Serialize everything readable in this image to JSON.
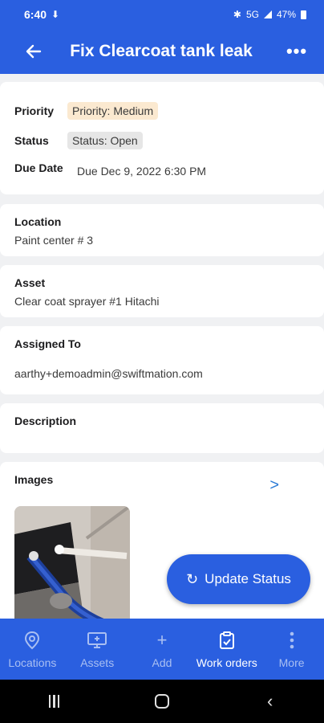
{
  "status_bar": {
    "time": "6:40",
    "network": "5G",
    "battery": "47%"
  },
  "header": {
    "title": "Fix Clearcoat tank leak",
    "back_icon": "arrow-left-icon",
    "more_icon": "more-horizontal-icon"
  },
  "summary": {
    "priority_label": "Priority",
    "priority_value": "Priority: Medium",
    "status_label": "Status",
    "status_value": "Status: Open",
    "due_label": "Due Date",
    "due_value": "Due Dec 9, 2022 6:30 PM"
  },
  "location": {
    "label": "Location",
    "value": "Paint center # 3"
  },
  "asset": {
    "label": "Asset",
    "value": "Clear coat sprayer #1 Hitachi"
  },
  "assigned": {
    "label": "Assigned To",
    "value": "aarthy+demoadmin@swiftmation.com"
  },
  "description": {
    "label": "Description"
  },
  "images": {
    "label": "Images",
    "arrow": ">"
  },
  "fab": {
    "label": "Update Status",
    "icon": "refresh-icon"
  },
  "bottom_nav": {
    "items": [
      {
        "label": "Locations",
        "icon": "location-pin-icon"
      },
      {
        "label": "Assets",
        "icon": "monitor-add-icon"
      },
      {
        "label": "Add",
        "icon": "plus-icon"
      },
      {
        "label": "Work orders",
        "icon": "clipboard-check-icon",
        "active": true
      },
      {
        "label": "More",
        "icon": "more-vertical-icon"
      }
    ]
  },
  "colors": {
    "primary": "#2a5fe0",
    "priority_bg": "#fbe9d0",
    "status_bg": "#e6e6e6",
    "link": "#2a7ad6"
  }
}
